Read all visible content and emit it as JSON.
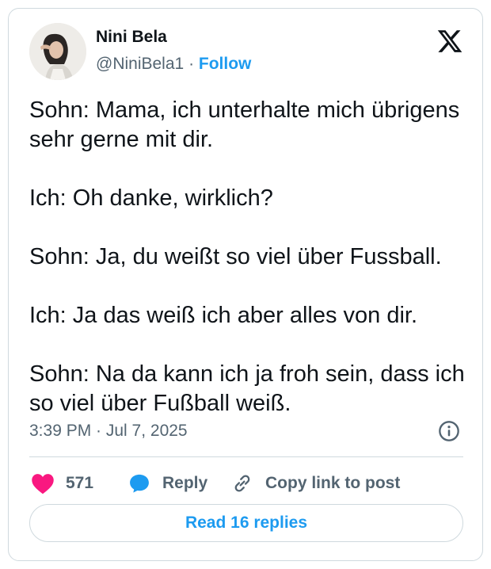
{
  "author": {
    "name": "Nini Bela",
    "handle": "@NiniBela1",
    "separator": "·",
    "follow_label": "Follow"
  },
  "tweet": {
    "text": "Sohn: Mama, ich unterhalte mich übrigens sehr gerne mit dir.\n\nIch: Oh danke, wirklich?\n\nSohn: Ja, du weißt so viel über Fussball.\n\nIch: Ja das weiß ich aber alles von dir.\n\nSohn: Na da kann ich ja froh sein, dass ich so viel über Fußball weiß.",
    "timestamp": "3:39 PM · Jul 7, 2025"
  },
  "actions": {
    "like_count": "571",
    "reply_label": "Reply",
    "copy_label": "Copy link to post"
  },
  "footer": {
    "read_replies_label": "Read 16 replies"
  },
  "colors": {
    "accent": "#1d9bf0",
    "like": "#f91880",
    "secondary_text": "#536471",
    "border": "#cfd9de"
  },
  "icons": {
    "logo": "x-logo-icon",
    "info": "info-icon",
    "like": "heart-icon",
    "reply": "speech-bubble-icon",
    "copy": "link-icon"
  }
}
